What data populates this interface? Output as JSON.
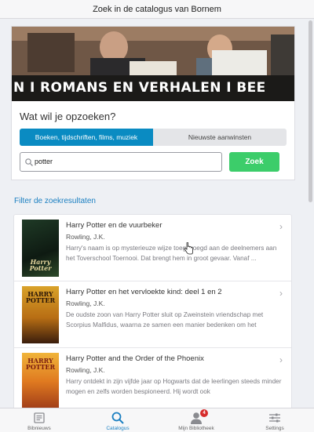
{
  "header": {
    "title": "Zoek in de catalogus van Bornem"
  },
  "banner": {
    "text": "N I ROMANS EN VERHALEN I BEE"
  },
  "search": {
    "question": "Wat wil je opzoeken?",
    "segments": [
      {
        "label": "Boeken, tijdschriften, films, muziek",
        "active": true
      },
      {
        "label": "Nieuwste aanwinsten",
        "active": false
      }
    ],
    "value": "potter",
    "button_label": "Zoek",
    "accent_color": "#0a8bc2",
    "button_color": "#3ccd6a"
  },
  "filter_label": "Filter de zoekresultaten",
  "results": [
    {
      "title": "Harry Potter en de vuurbeker",
      "author": "Rowling, J.K.",
      "description": "Harry's naam is op mysterieuze wijze toegevoegd aan de deelnemers aan het Toverschool Toernooi. Dat brengt hem in groot gevaar. Vanaf ...",
      "cover_text": "Harry Potter"
    },
    {
      "title": "Harry Potter en het vervloekte kind: deel 1 en 2",
      "author": "Rowling, J.K.",
      "description": "De oudste zoon van Harry Potter sluit op Zweinstein vriendschap met Scorpius Malfidus, waarna ze samen een manier bedenken om het",
      "cover_text": "HARRY POTTER"
    },
    {
      "title": "Harry Potter and the Order of the Phoenix",
      "author": "Rowling, J.K.",
      "description": "Harry ontdekt in zijn vijfde jaar op Hogwarts dat de leerlingen steeds minder mogen en zelfs worden bespioneerd. Hij wordt ook",
      "cover_text": "HARRY POTTER"
    }
  ],
  "tabs": [
    {
      "label": "Bibnieuws",
      "icon": "news-icon",
      "active": false
    },
    {
      "label": "Catalogus",
      "icon": "search-icon",
      "active": true
    },
    {
      "label": "Mijn Bibliotheek",
      "icon": "user-icon",
      "active": false,
      "badge": "4"
    },
    {
      "label": "Settings",
      "icon": "sliders-icon",
      "active": false
    }
  ]
}
